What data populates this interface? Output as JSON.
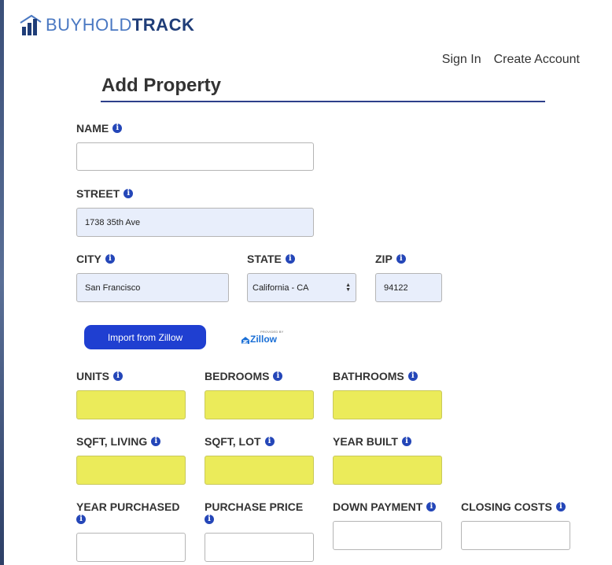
{
  "brand": {
    "part_light": "BUYHOLD",
    "part_bold": "TRACK"
  },
  "nav": {
    "sign_in": "Sign In",
    "create_account": "Create Account"
  },
  "page_title": "Add Property",
  "fields": {
    "name": {
      "label": "NAME",
      "value": ""
    },
    "street": {
      "label": "STREET",
      "value": "1738 35th Ave"
    },
    "city": {
      "label": "CITY",
      "value": "San Francisco"
    },
    "state": {
      "label": "STATE",
      "value": "California - CA"
    },
    "zip": {
      "label": "ZIP",
      "value": "94122"
    },
    "units": {
      "label": "UNITS",
      "value": ""
    },
    "bedrooms": {
      "label": "BEDROOMS",
      "value": ""
    },
    "bathrooms": {
      "label": "BATHROOMS",
      "value": ""
    },
    "sqft_living": {
      "label": "SQFT, LIVING",
      "value": ""
    },
    "sqft_lot": {
      "label": "SQFT, LOT",
      "value": ""
    },
    "year_built": {
      "label": "YEAR BUILT",
      "value": ""
    },
    "year_purchased": {
      "label": "YEAR PURCHASED",
      "value": ""
    },
    "purchase_price": {
      "label": "PURCHASE PRICE",
      "value": ""
    },
    "down_payment": {
      "label": "DOWN PAYMENT",
      "value": ""
    },
    "closing_costs": {
      "label": "CLOSING COSTS",
      "value": ""
    }
  },
  "import_button": "Import from Zillow",
  "zillow_badge": {
    "provided_by": "PROVIDED BY",
    "wordmark": "Zillow"
  },
  "info_glyph": "i",
  "icons": {
    "logo": "bar-chart-house-icon",
    "info": "info-circle-icon",
    "select": "updown-arrows-icon"
  },
  "colors": {
    "accent": "#1f3fd1",
    "brand_dark": "#1f3d78",
    "brand_light": "#4a78c2",
    "highlight": "#ebeb5a",
    "autofill": "#e8eefb"
  }
}
